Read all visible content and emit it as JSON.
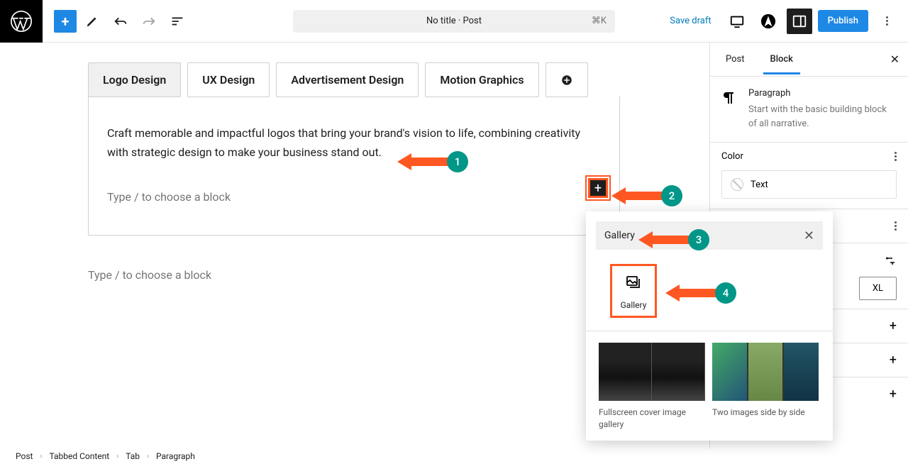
{
  "topbar": {
    "title": "No title · Post",
    "kbd": "⌘K",
    "save_draft": "Save draft",
    "publish": "Publish"
  },
  "tabs": {
    "items": [
      "Logo Design",
      "UX Design",
      "Advertisement Design",
      "Motion Graphics"
    ],
    "content_para": "Craft memorable and impactful logos that bring your brand's vision to life, combining creativity with strategic design to make your business stand out.",
    "placeholder": "Type / to choose a block"
  },
  "outer_placeholder": "Type / to choose a block",
  "sidebar": {
    "tab_post": "Post",
    "tab_block": "Block",
    "block_name": "Paragraph",
    "block_desc": "Start with the basic building block of all narrative.",
    "color_label": "Color",
    "text_label": "Text",
    "size_xl": "XL"
  },
  "inserter": {
    "search_value": "Gallery",
    "block_label": "Gallery",
    "pattern1_label": "Fullscreen cover image gallery",
    "pattern2_label": "Two images side by side"
  },
  "breadcrumb": {
    "items": [
      "Post",
      "Tabbed Content",
      "Tab",
      "Paragraph"
    ]
  },
  "annotations": {
    "n1": "1",
    "n2": "2",
    "n3": "3",
    "n4": "4"
  }
}
